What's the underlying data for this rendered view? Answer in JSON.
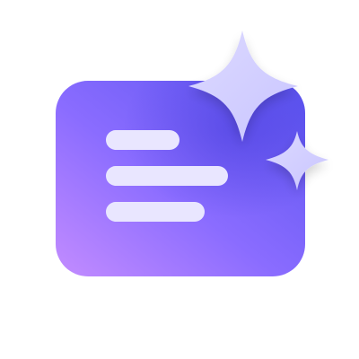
{
  "icon": {
    "name": "ai-summary-icon",
    "background": "#ffffff",
    "card": {
      "gradient_start": "#c38cff",
      "gradient_mid": "#8a6cff",
      "gradient_end": "#5c55f0"
    },
    "lines": {
      "color": "#e9e6ff",
      "count": 3
    },
    "sparkles": {
      "color": "#c9c5ff",
      "highlight": "#dcd9ff",
      "count": 2
    }
  }
}
